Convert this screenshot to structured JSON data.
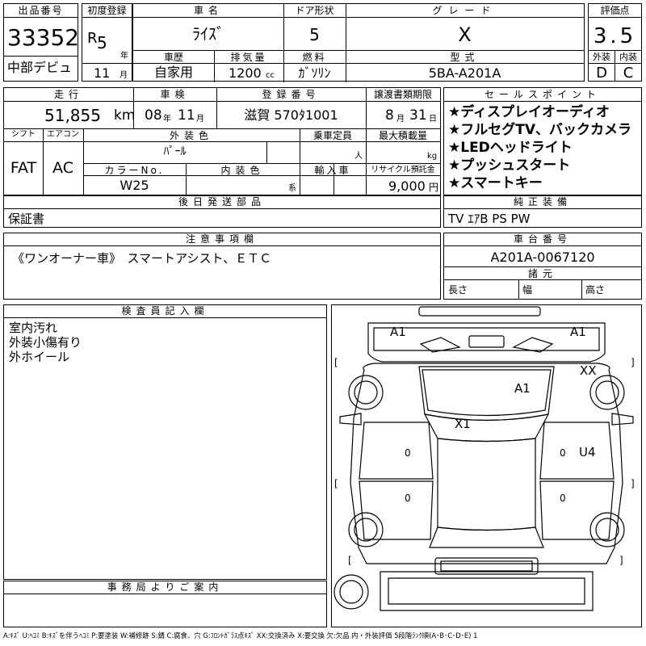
{
  "top": {
    "lot_label": "出品番号",
    "lot_no": "33352",
    "debut_note": "中部デビュ",
    "reg_year_label": "初度登録",
    "era": "R",
    "year": "5",
    "year_unit": "年",
    "month": "11",
    "month_unit": "月",
    "car_name_label": "車名",
    "car_name": "ﾗｲｽﾞ",
    "door_label": "ドア形状",
    "door": "5",
    "grade_label": "グレード",
    "grade": "X",
    "score_label": "評価点",
    "score": "3.5",
    "history_label": "車歴",
    "history": "自家用",
    "displacement_label": "排気量",
    "displacement": "1200",
    "displacement_unit": "cc",
    "fuel_label": "燃料",
    "fuel": "ｶﾞｿﾘﾝ",
    "model_label": "型式",
    "model": "5BA-A201A",
    "exterior_label": "外装",
    "exterior": "D",
    "interior_label": "内装",
    "interior": "C"
  },
  "row2": {
    "mileage_label": "走行",
    "mileage": "51,855",
    "mileage_unit": "km",
    "inspection_label": "車検",
    "insp_year": "08",
    "insp_year_unit": "年",
    "insp_month": "11",
    "insp_month_unit": "月",
    "plate_label": "登録番号",
    "plate": "滋賀 570ﾀ1001",
    "transfer_label": "譲渡書類期限",
    "transfer_month": "8",
    "transfer_month_unit": "月",
    "transfer_day": "31",
    "transfer_day_unit": "日"
  },
  "row3": {
    "shift_label": "シフト",
    "shift": "FAT",
    "aircon_label": "エアコン",
    "aircon": "AC",
    "ext_color_label": "外装色",
    "ext_color": "ﾊﾟｰﾙ",
    "capacity_label": "乗車定員",
    "capacity_unit": "人",
    "load_label": "最大積載量",
    "load_unit": "kg",
    "color_no_label": "カラーNo.",
    "color_no": "W25",
    "int_color_label": "内装色",
    "int_color_unit": "系",
    "import_label": "輸入車",
    "recycle_label": "リサイクル預託金",
    "recycle": "9,000",
    "recycle_unit": "円"
  },
  "parts": {
    "label": "後日発送部品",
    "value": "保証書"
  },
  "sales_points": {
    "label": "セールスポイント",
    "items": [
      "★ディスプレイオーディオ",
      "★フルセグTV、バックカメラ",
      "★LEDヘッドライト",
      "★プッシュスタート",
      "★スマートキー"
    ]
  },
  "equipment": {
    "label": "純正装備",
    "value": "TV ｴｱB PS PW"
  },
  "notes": {
    "label": "注意事項欄",
    "value": "《ワンオーナー車》　スマートアシスト、ＥＴＣ"
  },
  "chassis": {
    "label": "車台番号",
    "value": "A201A-0067120",
    "spec_label": "諸元",
    "length_label": "長さ",
    "width_label": "幅",
    "height_label": "高さ"
  },
  "inspector": {
    "label": "検査員記入欄",
    "lines": [
      "室内汚れ",
      "外装小傷有り",
      "外ホイール"
    ]
  },
  "office": {
    "label": "事務局よりご案内"
  },
  "diagram": {
    "marks": {
      "a1_left": "A1",
      "a1_right": "A1",
      "xx": "XX",
      "a1_roof": "A1",
      "x1": "X1",
      "u4": "U4",
      "zero_left": "0",
      "zero_right": "0",
      "zero_rear_left": "0",
      "zero_rear_right": "0"
    }
  },
  "legend": "A:ｷｽﾞ U:ﾍｺﾐ B:ｷｽﾞを伴うﾍｺﾐ P:要塗装 W:補修跡 S:錆 C:腐食、穴 G:ﾌﾛﾝﾄｶﾞﾗｽ点ｷｽﾞ XX:交換済み X:要交換 欠:欠品 内・外装評価 5段階ﾗﾝｸ順(A･B･C･D･E) 1"
}
